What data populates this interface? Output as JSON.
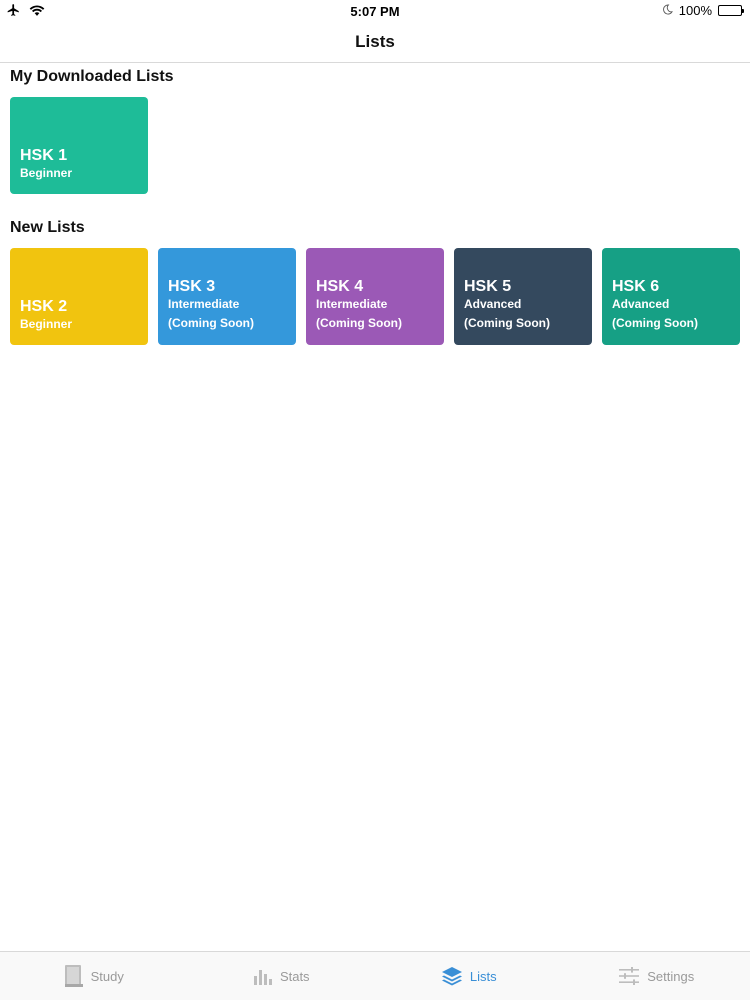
{
  "status_bar": {
    "time": "5:07 PM",
    "battery": "100%",
    "icons": [
      "airplane-icon",
      "wifi-icon",
      "moon-icon",
      "battery-icon"
    ]
  },
  "nav": {
    "title": "Lists"
  },
  "downloaded": {
    "title": "My Downloaded Lists",
    "cards": [
      {
        "title": "HSK 1",
        "subtitle": "Beginner",
        "color": "#1ebc98"
      }
    ]
  },
  "new_lists": {
    "title": "New Lists",
    "cards": [
      {
        "title": "HSK 2",
        "subtitle": "Beginner",
        "note": "",
        "color": "#f1c40f"
      },
      {
        "title": "HSK 3",
        "subtitle": "Intermediate",
        "note": "(Coming Soon)",
        "color": "#3498db"
      },
      {
        "title": "HSK 4",
        "subtitle": "Intermediate",
        "note": "(Coming Soon)",
        "color": "#9b59b6"
      },
      {
        "title": "HSK 5",
        "subtitle": "Advanced",
        "note": "(Coming Soon)",
        "color": "#34495e"
      },
      {
        "title": "HSK 6",
        "subtitle": "Advanced",
        "note": "(Coming Soon)",
        "color": "#16a085"
      }
    ]
  },
  "tab_bar": {
    "active_color": "#3a8fd6",
    "inactive_color": "#9a9a9a",
    "tabs": [
      {
        "label": "Study",
        "icon": "book-icon",
        "active": false
      },
      {
        "label": "Stats",
        "icon": "bar-chart-icon",
        "active": false
      },
      {
        "label": "Lists",
        "icon": "layers-icon",
        "active": true
      },
      {
        "label": "Settings",
        "icon": "sliders-icon",
        "active": false
      }
    ]
  }
}
